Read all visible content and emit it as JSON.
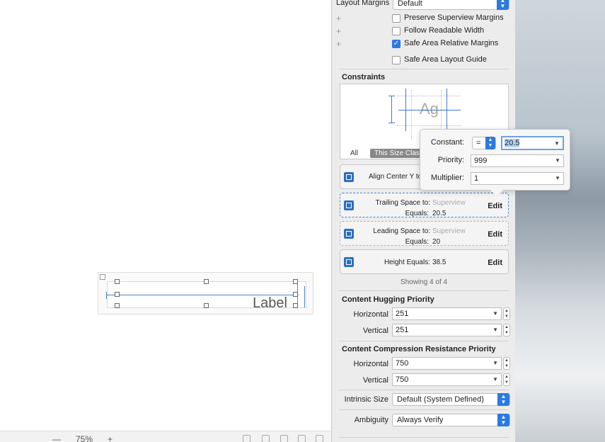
{
  "canvas": {
    "label_text": "Label",
    "zoom": "75%",
    "zoom_out": "—",
    "zoom_in": "+"
  },
  "layout_margins": {
    "label": "Layout Margins",
    "value": "Default"
  },
  "checkboxes": [
    {
      "label": "Preserve Superview Margins",
      "checked": false
    },
    {
      "label": "Follow Readable Width",
      "checked": false
    },
    {
      "label": "Safe Area Relative Margins",
      "checked": true
    },
    {
      "label": "Safe Area Layout Guide",
      "checked": false
    }
  ],
  "constraints": {
    "title": "Constraints",
    "preview_text": "Ag",
    "seg_all": "All",
    "seg_size": "This Size Class",
    "items": [
      {
        "name": "Align Center Y to:",
        "target": "",
        "equals_label": "",
        "value": "",
        "edit": ""
      },
      {
        "name": "Trailing Space to:",
        "target": "Superview",
        "equals_label": "Equals:",
        "value": "20.5",
        "edit": "Edit"
      },
      {
        "name": "Leading Space to:",
        "target": "Superview",
        "equals_label": "Equals:",
        "value": "20",
        "edit": "Edit"
      },
      {
        "name": "Height Equals:",
        "target": "",
        "equals_label": "",
        "value": "38.5",
        "edit": "Edit"
      }
    ],
    "showing": "Showing 4 of 4"
  },
  "hugging": {
    "title": "Content Hugging Priority",
    "horizontal_label": "Horizontal",
    "horizontal": "251",
    "vertical_label": "Vertical",
    "vertical": "251"
  },
  "compression": {
    "title": "Content Compression Resistance Priority",
    "horizontal_label": "Horizontal",
    "horizontal": "750",
    "vertical_label": "Vertical",
    "vertical": "750"
  },
  "intrinsic": {
    "label": "Intrinsic Size",
    "value": "Default (System Defined)"
  },
  "ambiguity": {
    "label": "Ambiguity",
    "value": "Always Verify"
  },
  "popover": {
    "constant_label": "Constant:",
    "relation": "=",
    "constant": "20.5",
    "priority_label": "Priority:",
    "priority": "999",
    "multiplier_label": "Multiplier:",
    "multiplier": "1"
  },
  "colors": {
    "accent": "#2a7ae2",
    "constraint_blue": "#4a86c8"
  }
}
